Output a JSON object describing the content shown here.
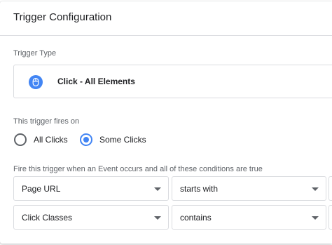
{
  "header": {
    "title": "Trigger Configuration"
  },
  "trigger_type": {
    "label": "Trigger Type",
    "value": "Click - All Elements",
    "icon": "mouse-icon",
    "icon_color": "#4285f4"
  },
  "fires_on": {
    "label": "This trigger fires on",
    "options": [
      {
        "label": "All Clicks",
        "selected": false
      },
      {
        "label": "Some Clicks",
        "selected": true
      }
    ]
  },
  "conditions": {
    "label": "Fire this trigger when an Event occurs and all of these conditions are true",
    "rows": [
      {
        "variable": "Page URL",
        "operator": "starts with",
        "value": ""
      },
      {
        "variable": "Click Classes",
        "operator": "contains",
        "value": ""
      }
    ]
  },
  "colors": {
    "accent": "#4285f4",
    "border": "#dadce0",
    "label": "#5f6368",
    "text": "#202124"
  }
}
